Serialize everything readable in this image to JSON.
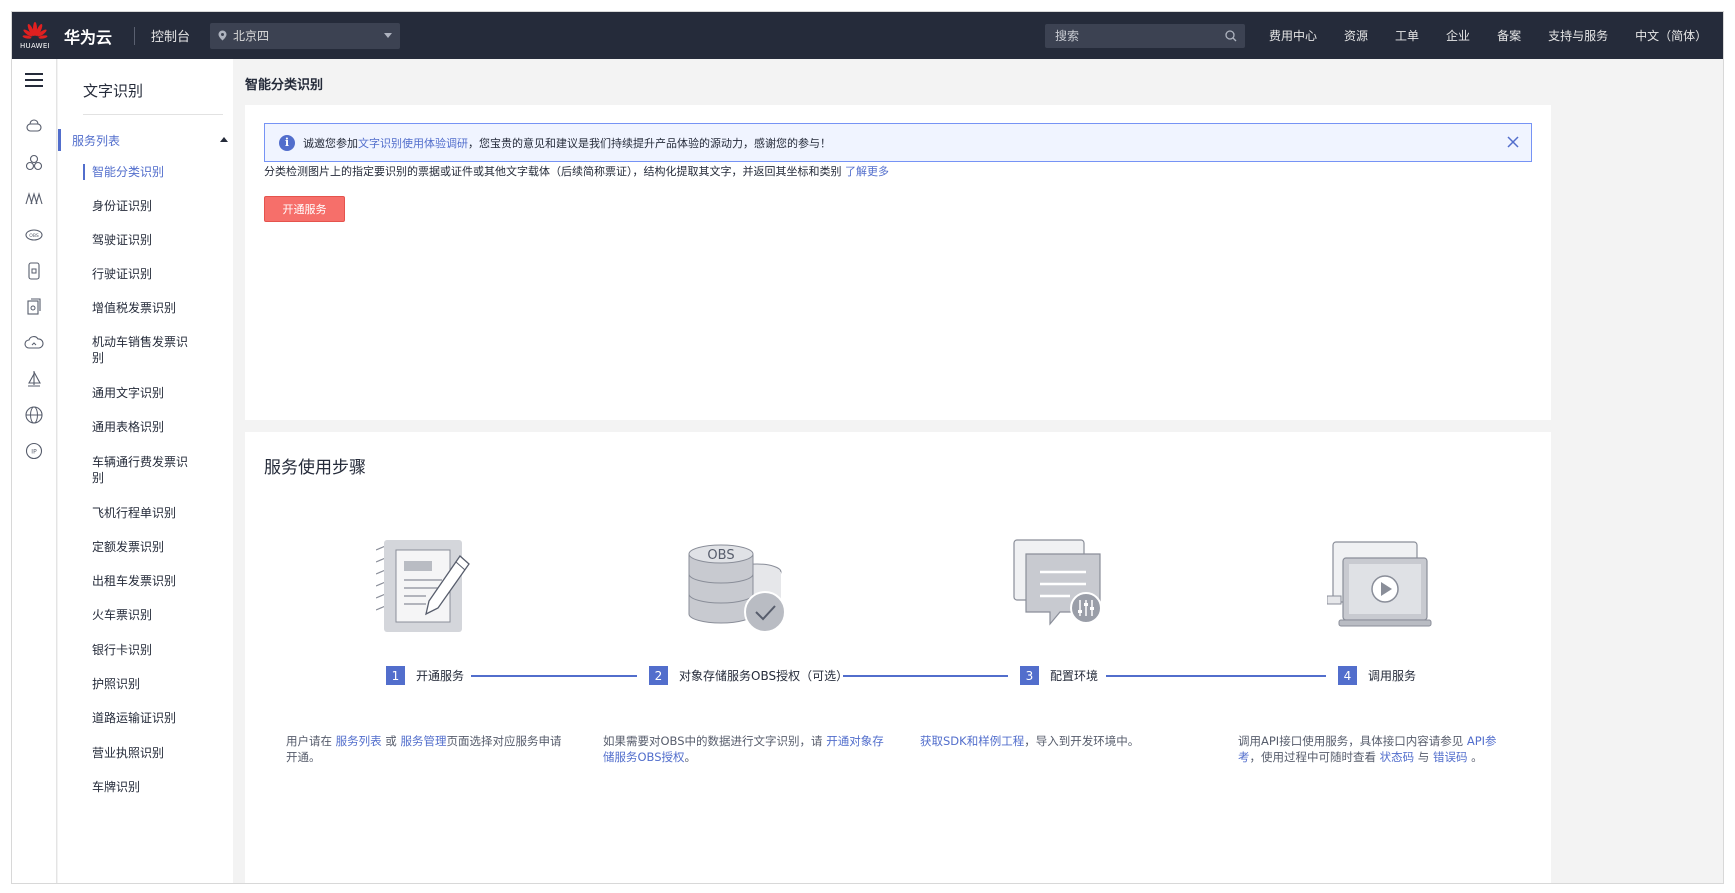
{
  "colors": {
    "topbar": "#252b3a",
    "accent": "#526ecc",
    "primary_button": "#f66f6a",
    "notice_bg": "#f0f4ff"
  },
  "topbar": {
    "logo_text": "HUAWEI",
    "brand": "华为云",
    "console": "控制台",
    "region": "北京四",
    "search_placeholder": "搜索",
    "nav": [
      "费用中心",
      "资源",
      "工单",
      "企业",
      "备案",
      "支持与服务",
      "中文（简体）"
    ]
  },
  "rail_icons": [
    "cloud-server-icon",
    "cluster-icon",
    "network-icon",
    "storage-icon",
    "database-icon",
    "document-icon",
    "cloud-icon",
    "sail-icon",
    "globe-icon",
    "ip-icon"
  ],
  "sidebar": {
    "title": "文字识别",
    "group": "服务列表",
    "items": [
      "智能分类识别",
      "身份证识别",
      "驾驶证识别",
      "行驶证识别",
      "增值税发票识别",
      "机动车销售发票识别",
      "通用文字识别",
      "通用表格识别",
      "车辆通行费发票识别",
      "飞机行程单识别",
      "定额发票识别",
      "出租车发票识别",
      "火车票识别",
      "银行卡识别",
      "护照识别",
      "道路运输证识别",
      "营业执照识别",
      "车牌识别"
    ]
  },
  "main": {
    "page_title": "智能分类识别",
    "notice": {
      "before": "诚邀您参加",
      "link": "文字识别使用体验调研",
      "after": "，您宝贵的意见和建议是我们持续提升产品体验的源动力，感谢您的参与！"
    },
    "description": "分类检测图片上的指定要识别的票据或证件或其他文字载体（后续简称票证），结构化提取其文字，并返回其坐标和类别",
    "learn_more": "了解更多",
    "open_button": "开通服务",
    "steps_title": "服务使用步骤",
    "obs_label": "OBS",
    "steps": [
      {
        "num": "1",
        "label": "开通服务"
      },
      {
        "num": "2",
        "label": "对象存储服务OBS授权（可选）"
      },
      {
        "num": "3",
        "label": "配置环境"
      },
      {
        "num": "4",
        "label": "调用服务"
      }
    ],
    "step_desc": {
      "s1_a": "用户请在 ",
      "s1_link1": "服务列表",
      "s1_b": " 或 ",
      "s1_link2": "服务管理",
      "s1_c": "页面选择对应服务申请开通。",
      "s2_a": "如果需要对OBS中的数据进行文字识别，请 ",
      "s2_link": "开通对象存储服务OBS授权",
      "s2_b": "。",
      "s3_link": "获取SDK和样例工程",
      "s3_b": "，导入到开发环境中。",
      "s4_a": "调用API接口使用服务，具体接口内容请参见 ",
      "s4_link1": "API参考",
      "s4_b": "，使用过程中可随时查看 ",
      "s4_link2": "状态码",
      "s4_c": " 与 ",
      "s4_link3": "错误码",
      "s4_d": " 。"
    }
  }
}
